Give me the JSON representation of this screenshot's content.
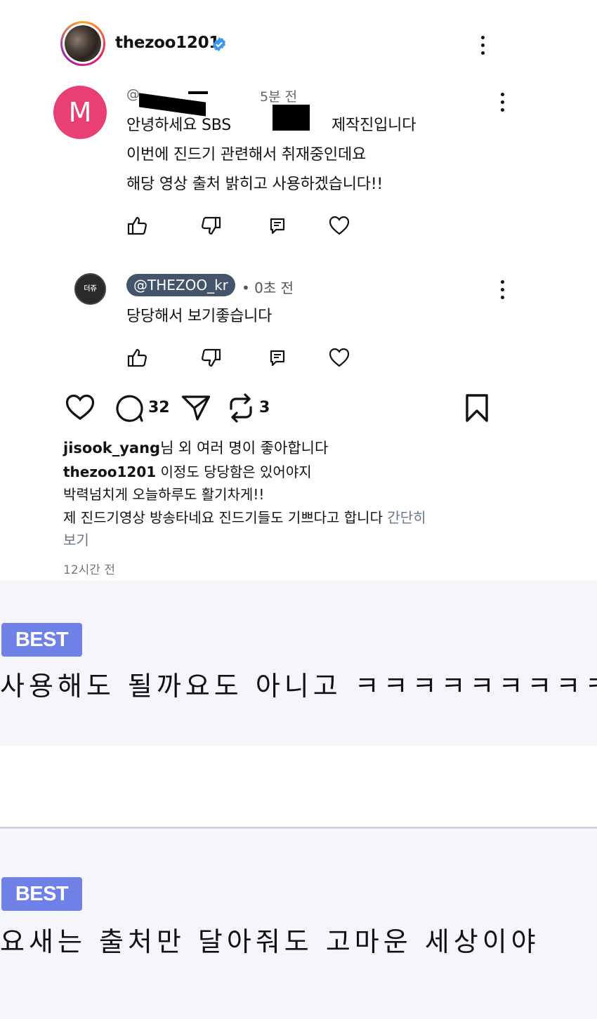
{
  "post": {
    "username": "thezoo1201",
    "verified_icon": "verified-badge-icon",
    "menu_icon": "more-vertical-icon"
  },
  "comments": [
    {
      "avatar_letter": "M",
      "avatar_color": "#ea3f72",
      "meta_prefix": "@",
      "time": "5분 전",
      "lines": [
        "안녕하세요 SBS",
        "제작진입니다",
        "이번에 진드기 관련해서 취재중인데요",
        "해당 영상 출처 밝히고 사용하겠습니다!!"
      ]
    },
    {
      "avatar_text": "더쥬",
      "handle": "@THEZOO_kr",
      "time": "• 0초 전",
      "text": "당당해서 보기좋습니다"
    }
  ],
  "actions": {
    "comment_count": "32",
    "repost_count": "3"
  },
  "caption": {
    "likes_user": "jisook_yang",
    "likes_suffix": "님 외 여러 명이 좋아합니다",
    "author": "thezoo1201",
    "line1": "이정도 당당함은 있어야지",
    "line2": "박력넘치게 오늘하루도 활기차게!!",
    "line3": "제 진드기영상 방송타네요 진드기들도 기쁘다고 합니다",
    "more_part1": "간단히",
    "more_part2": "보기",
    "time": "12시간 전"
  },
  "best_comments": [
    {
      "badge": "BEST",
      "text": "사용해도 될까요도 아니고 ㅋㅋㅋㅋㅋㅋㅋㅋㅋ"
    },
    {
      "badge": "BEST",
      "text": "요새는 출처만 달아줘도 고마운 세상이야"
    }
  ],
  "colors": {
    "accent_handle_bg": "#44546a",
    "best_badge": "#6f80e6",
    "best_bg": "#f4f6fb",
    "verified": "#3897f0"
  }
}
